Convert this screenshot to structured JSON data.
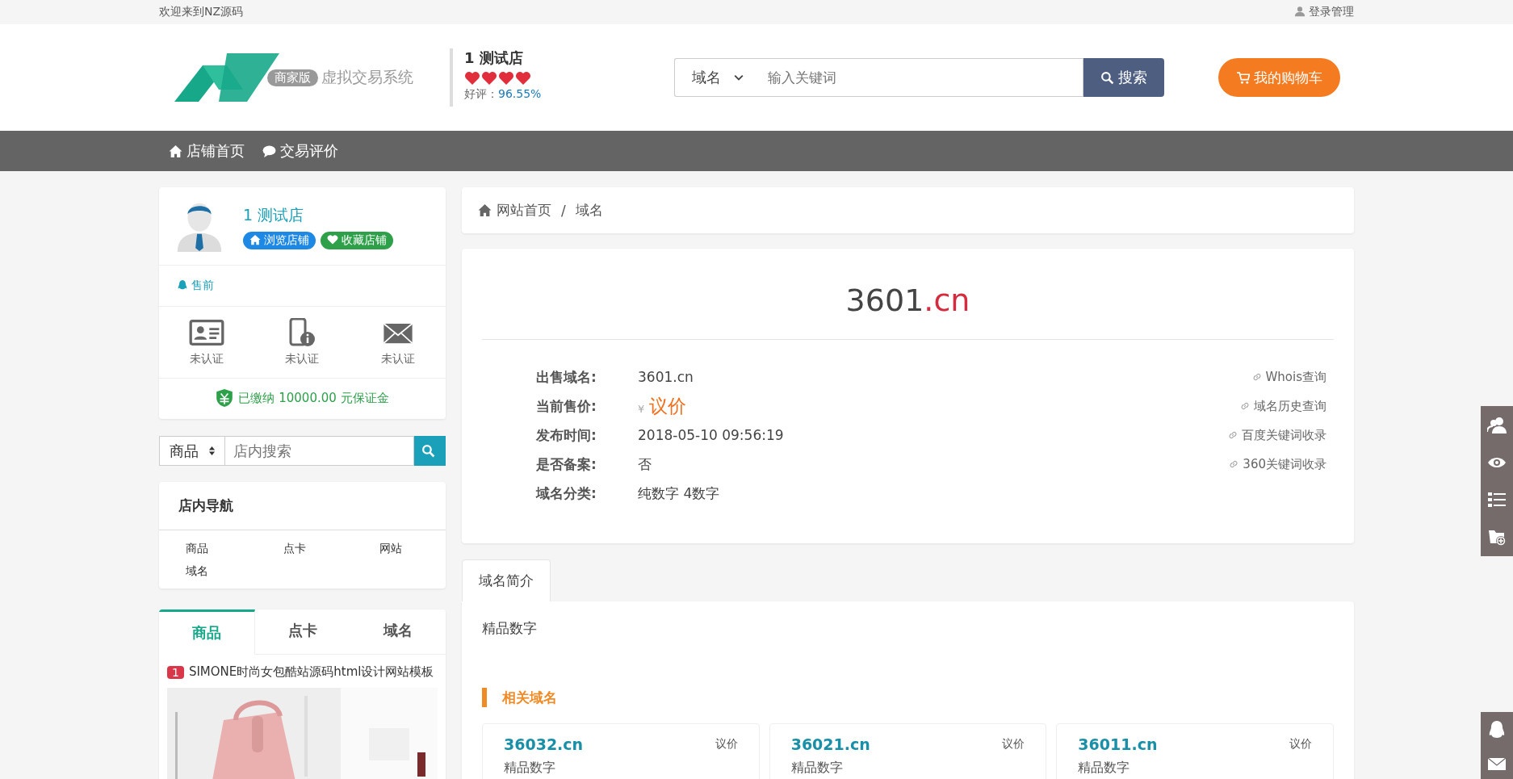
{
  "topbar": {
    "welcome": "欢迎来到NZ源码",
    "login": "登录管理"
  },
  "header": {
    "logo_badge": "商家版",
    "logo_text": "虚拟交易系统",
    "shop_name": "1 测试店",
    "stars": 4,
    "rating_label": "好评：",
    "rating_value": "96.55%",
    "search": {
      "select": "域名",
      "placeholder": "输入关键词",
      "button": "搜索"
    },
    "cart": "我的购物车"
  },
  "nav": [
    {
      "label": "店铺首页",
      "kind": "home"
    },
    {
      "label": "交易评价",
      "kind": "comment"
    }
  ],
  "sidebar": {
    "shop_name": "1 测试店",
    "buttons": [
      {
        "label": "浏览店铺",
        "kind": "browse"
      },
      {
        "label": "收藏店铺",
        "kind": "favorite"
      }
    ],
    "presale": "售前",
    "verifications": [
      {
        "kind": "id",
        "label": "未认证"
      },
      {
        "kind": "phone",
        "label": "未认证"
      },
      {
        "kind": "mail",
        "label": "未认证"
      }
    ],
    "deposit": "已缴纳 10000.00 元保证金",
    "search": {
      "select": "商品",
      "placeholder": "店内搜索"
    },
    "nav_title": "店内导航",
    "nav_items": [
      "商品",
      "点卡",
      "网站",
      "域名"
    ],
    "tabs": [
      {
        "label": "商品",
        "selected": true
      },
      {
        "label": "点卡",
        "selected": false
      },
      {
        "label": "域名",
        "selected": false
      }
    ],
    "products": [
      {
        "rank": "1",
        "title": "SIMONE时尚女包酷站源码html设计网站模板",
        "kind": "picture"
      }
    ]
  },
  "breadcrumb": {
    "items": [
      "网站首页",
      "域名"
    ],
    "separator": "/"
  },
  "domain": {
    "name": "3601",
    "tld": ".cn",
    "fields": [
      {
        "label": "出售域名:",
        "value": "3601.cn",
        "kind": "text"
      },
      {
        "label": "当前售价:",
        "currency": "¥",
        "value": "议价",
        "kind": "price"
      },
      {
        "label": "发布时间:",
        "value": "2018-05-10 09:56:19",
        "kind": "text"
      },
      {
        "label": "是否备案:",
        "value": "否",
        "kind": "text"
      },
      {
        "label": "域名分类:",
        "value": "纯数字 4数字",
        "kind": "text"
      }
    ],
    "links": [
      "Whois查询",
      "域名历史查询",
      "百度关键词收录",
      "360关键词收录"
    ]
  },
  "tabs": [
    {
      "label": "域名简介",
      "selected": true
    }
  ],
  "intro": "精品数字",
  "related_title": "相关域名",
  "related": [
    {
      "name": "36032.cn",
      "price": "议价",
      "desc": "精品数字"
    },
    {
      "name": "36021.cn",
      "price": "议价",
      "desc": "精品数字"
    },
    {
      "name": "36011.cn",
      "price": "议价",
      "desc": "精品数字"
    }
  ]
}
